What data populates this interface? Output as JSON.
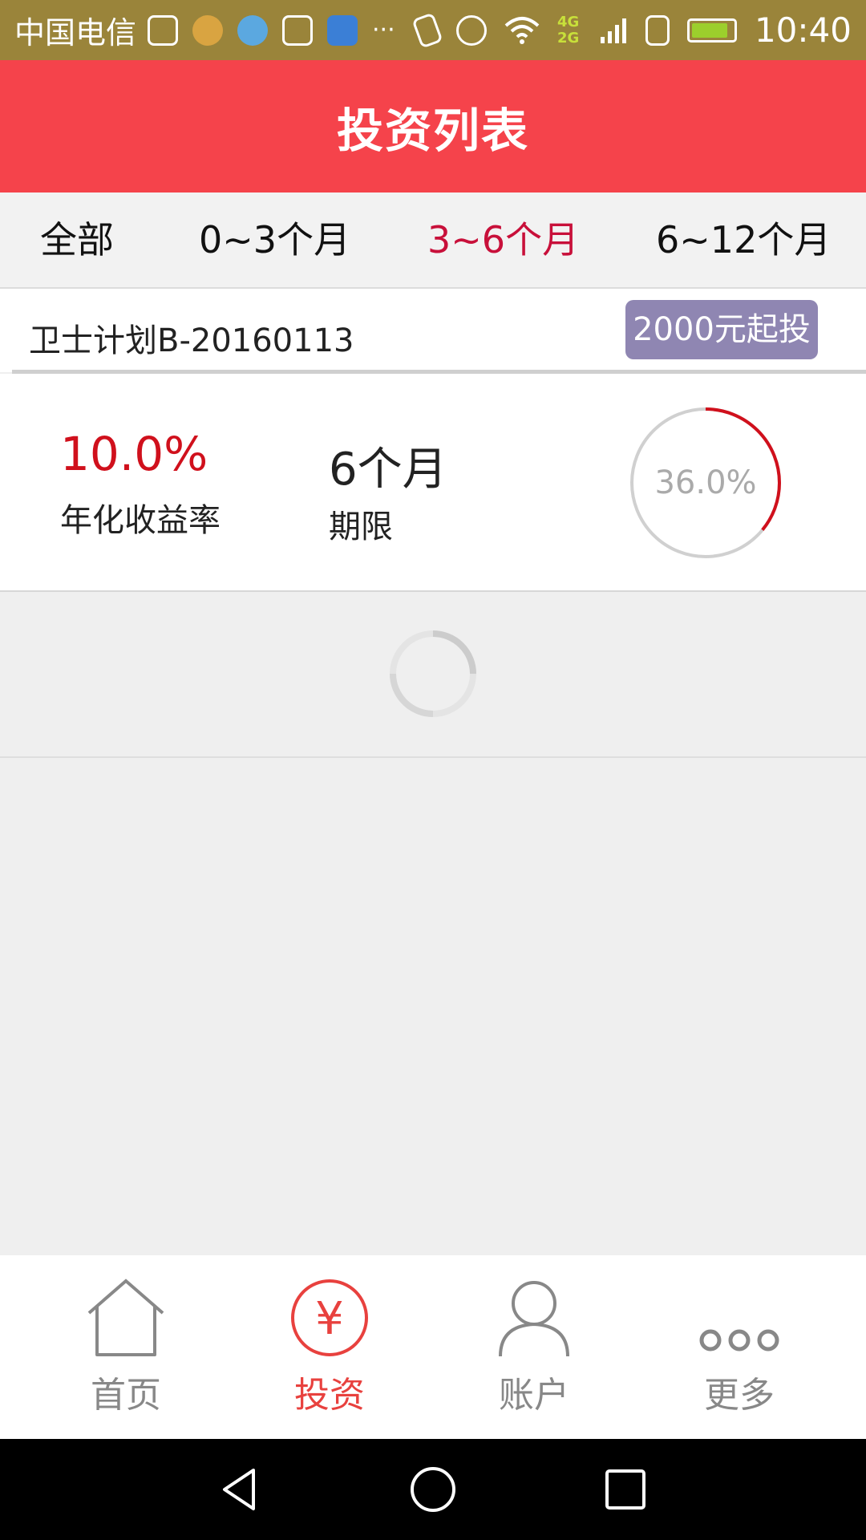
{
  "status_bar": {
    "carrier": "中国电信",
    "notifications": [
      "check-icon",
      "app-avatar-icon",
      "health-app-icon",
      "gallery-icon",
      "star-app-icon"
    ],
    "more_indicator": "···",
    "network": "4G 2G",
    "time": "10:40",
    "battery_color": "#9ccf2c"
  },
  "header": {
    "title": "投资列表",
    "background": "#f5434b"
  },
  "filter_tabs": [
    {
      "label": "全部",
      "active": false
    },
    {
      "label": "0~3个月",
      "active": false
    },
    {
      "label": "3~6个月",
      "active": true
    },
    {
      "label": "6~12个月",
      "active": false
    }
  ],
  "products": [
    {
      "name": "卫士计划B-20160113",
      "badge": "2000元起投",
      "rate_value": "10.0%",
      "rate_label": "年化收益率",
      "term_value": "6个月",
      "term_label": "期限",
      "progress_text": "36.0%",
      "progress": 0.36
    }
  ],
  "bottom_nav": [
    {
      "label": "首页",
      "icon": "home-icon",
      "active": false
    },
    {
      "label": "投资",
      "icon": "yen-icon",
      "active": true
    },
    {
      "label": "账户",
      "icon": "user-icon",
      "active": false
    },
    {
      "label": "更多",
      "icon": "more-dots-icon",
      "active": false
    }
  ],
  "colors": {
    "accent": "#e8413e",
    "active_tab": "#c8103a",
    "rate": "#d0101c",
    "badge": "#8f86b2"
  }
}
